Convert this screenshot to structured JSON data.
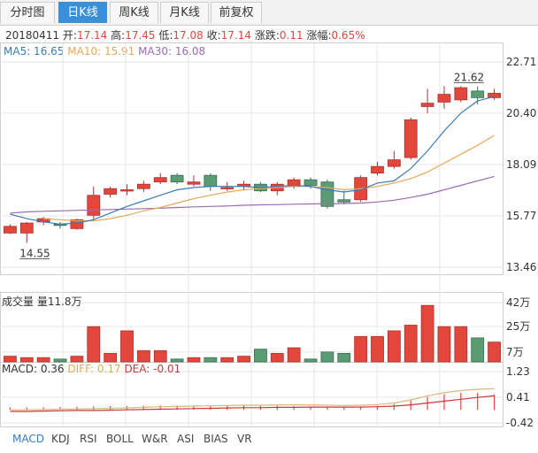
{
  "tabs": [
    {
      "label": "分时图",
      "active": false
    },
    {
      "label": "日K线",
      "active": true
    },
    {
      "label": "周K线",
      "active": false
    },
    {
      "label": "月K线",
      "active": false
    },
    {
      "label": "前复权",
      "active": false
    }
  ],
  "info": {
    "date": "20180411",
    "open_label": "开:",
    "open": "17.14",
    "high_label": "高:",
    "high": "17.45",
    "low_label": "低:",
    "low": "17.08",
    "close_label": "收:",
    "close": "17.14",
    "change_label": "涨跌:",
    "change": "0.11",
    "pct_label": "涨幅:",
    "pct": "0.65%"
  },
  "ma_legend": {
    "ma5": "MA5: 16.65",
    "ma10": "MA10: 15.91",
    "ma30": "MA30: 16.08"
  },
  "volume_title": "成交量 量11.8万",
  "macd_legend": {
    "macd": "MACD: 0.36",
    "diff": "DIFF: 0.17",
    "dea": "DEA: -0.01"
  },
  "indicator_tabs": [
    {
      "label": "MACD",
      "active": true
    },
    {
      "label": "KDJ",
      "active": false
    },
    {
      "label": "RSI",
      "active": false
    },
    {
      "label": "BOLL",
      "active": false
    },
    {
      "label": "W&R",
      "active": false
    },
    {
      "label": "ASI",
      "active": false
    },
    {
      "label": "BIAS",
      "active": false
    },
    {
      "label": "VR",
      "active": false
    }
  ],
  "colors": {
    "up": "#e3463b",
    "down": "#5a9c74",
    "ma5": "#3a7bb5",
    "ma10": "#e8a85a",
    "ma30": "#9b6bb5",
    "grid": "#e6e6e6",
    "dea": "#c9383c",
    "diff": "#d8b878"
  },
  "chart_data": {
    "type": "candlestick",
    "price_axis": {
      "ticks": [
        "22.71",
        "20.40",
        "18.09",
        "15.77",
        "13.46"
      ],
      "ylim": [
        13.46,
        22.71
      ]
    },
    "volume_axis": {
      "ticks": [
        "42万",
        "25万",
        "7万"
      ],
      "ylim": [
        0,
        42
      ]
    },
    "macd_axis": {
      "ticks": [
        "1.23",
        "0.41",
        "-0.42"
      ],
      "ylim": [
        -0.42,
        1.23
      ]
    },
    "annotations": [
      {
        "text": "14.55",
        "index": 1,
        "value": 14.55
      },
      {
        "text": "21.62",
        "index": 27,
        "value": 21.62
      }
    ],
    "candles": [
      {
        "open": 15.0,
        "close": 15.3,
        "high": 15.4,
        "low": 14.95,
        "volume": 4
      },
      {
        "open": 15.0,
        "close": 15.45,
        "high": 15.5,
        "low": 14.55,
        "volume": 3
      },
      {
        "open": 15.5,
        "close": 15.65,
        "high": 15.72,
        "low": 15.35,
        "volume": 3
      },
      {
        "open": 15.4,
        "close": 15.38,
        "high": 15.5,
        "low": 15.2,
        "volume": 2
      },
      {
        "open": 15.2,
        "close": 15.6,
        "high": 15.65,
        "low": 15.15,
        "volume": 4
      },
      {
        "open": 15.8,
        "close": 16.7,
        "high": 17.1,
        "low": 15.6,
        "volume": 25
      },
      {
        "open": 16.75,
        "close": 17.0,
        "high": 17.1,
        "low": 16.6,
        "volume": 6
      },
      {
        "open": 16.95,
        "close": 16.95,
        "high": 17.2,
        "low": 16.7,
        "volume": 22
      },
      {
        "open": 17.0,
        "close": 17.2,
        "high": 17.35,
        "low": 16.85,
        "volume": 8
      },
      {
        "open": 17.3,
        "close": 17.5,
        "high": 17.7,
        "low": 17.2,
        "volume": 8
      },
      {
        "open": 17.6,
        "close": 17.3,
        "high": 17.7,
        "low": 17.2,
        "volume": 2
      },
      {
        "open": 17.2,
        "close": 17.3,
        "high": 17.6,
        "low": 17.1,
        "volume": 3
      },
      {
        "open": 17.6,
        "close": 17.1,
        "high": 17.7,
        "low": 16.9,
        "volume": 3
      },
      {
        "open": 17.0,
        "close": 17.05,
        "high": 17.3,
        "low": 16.9,
        "volume": 3
      },
      {
        "open": 17.1,
        "close": 17.2,
        "high": 17.35,
        "low": 16.95,
        "volume": 4
      },
      {
        "open": 17.2,
        "close": 16.9,
        "high": 17.3,
        "low": 16.85,
        "volume": 9
      },
      {
        "open": 16.9,
        "close": 17.2,
        "high": 17.3,
        "low": 16.7,
        "volume": 6
      },
      {
        "open": 17.1,
        "close": 17.4,
        "high": 17.5,
        "low": 17.0,
        "volume": 10
      },
      {
        "open": 17.4,
        "close": 17.15,
        "high": 17.5,
        "low": 17.0,
        "volume": 2
      },
      {
        "open": 17.3,
        "close": 16.2,
        "high": 17.4,
        "low": 16.1,
        "volume": 7
      },
      {
        "open": 16.5,
        "close": 16.4,
        "high": 16.9,
        "low": 16.3,
        "volume": 6
      },
      {
        "open": 16.5,
        "close": 17.5,
        "high": 17.6,
        "low": 16.4,
        "volume": 18
      },
      {
        "open": 17.7,
        "close": 18.0,
        "high": 18.2,
        "low": 17.6,
        "volume": 18
      },
      {
        "open": 18.0,
        "close": 18.3,
        "high": 18.7,
        "low": 17.9,
        "volume": 22
      },
      {
        "open": 18.4,
        "close": 20.1,
        "high": 20.2,
        "low": 18.3,
        "volume": 26
      },
      {
        "open": 20.7,
        "close": 20.85,
        "high": 21.5,
        "low": 20.4,
        "volume": 40
      },
      {
        "open": 20.9,
        "close": 21.25,
        "high": 21.62,
        "low": 20.6,
        "volume": 25
      },
      {
        "open": 21.0,
        "close": 21.55,
        "high": 21.62,
        "low": 20.9,
        "volume": 25
      },
      {
        "open": 21.4,
        "close": 21.1,
        "high": 21.6,
        "low": 20.8,
        "volume": 17
      },
      {
        "open": 21.1,
        "close": 21.3,
        "high": 21.5,
        "low": 21.0,
        "volume": 14
      }
    ],
    "ma5": [
      15.85,
      15.65,
      15.5,
      15.4,
      15.45,
      15.6,
      15.9,
      16.2,
      16.45,
      16.7,
      16.95,
      17.05,
      17.1,
      17.1,
      17.1,
      17.05,
      17.1,
      17.15,
      17.1,
      16.95,
      16.85,
      16.95,
      17.25,
      17.35,
      17.9,
      18.7,
      19.6,
      20.4,
      20.95,
      21.15
    ],
    "ma10": [
      null,
      null,
      15.65,
      15.6,
      15.55,
      15.55,
      15.65,
      15.8,
      16.0,
      16.15,
      16.35,
      16.55,
      16.7,
      16.85,
      16.95,
      17.0,
      17.05,
      17.1,
      17.1,
      17.05,
      16.95,
      17.0,
      17.1,
      17.25,
      17.45,
      17.75,
      18.15,
      18.55,
      18.95,
      19.4
    ],
    "ma30": [
      15.9,
      15.95,
      15.98,
      16.0,
      16.02,
      16.04,
      16.06,
      16.08,
      16.1,
      16.12,
      16.15,
      16.18,
      16.2,
      16.22,
      16.25,
      16.27,
      16.28,
      16.3,
      16.31,
      16.32,
      16.33,
      16.35,
      16.4,
      16.48,
      16.6,
      16.75,
      16.95,
      17.15,
      17.35,
      17.55
    ],
    "macd_diff": [
      0.0,
      0.0,
      0.01,
      0.02,
      0.03,
      0.04,
      0.05,
      0.06,
      0.08,
      0.1,
      0.11,
      0.12,
      0.13,
      0.14,
      0.15,
      0.15,
      0.16,
      0.16,
      0.16,
      0.15,
      0.14,
      0.15,
      0.17,
      0.22,
      0.32,
      0.45,
      0.55,
      0.62,
      0.66,
      0.68
    ],
    "macd_dea": [
      -0.05,
      -0.05,
      -0.04,
      -0.03,
      -0.02,
      -0.02,
      -0.01,
      0.0,
      0.01,
      0.02,
      0.03,
      0.04,
      0.05,
      0.06,
      0.07,
      0.07,
      0.08,
      0.08,
      0.09,
      0.09,
      0.09,
      0.09,
      0.1,
      0.12,
      0.16,
      0.22,
      0.28,
      0.34,
      0.4,
      0.45
    ],
    "macd_hist": [
      0.08,
      0.08,
      0.08,
      0.09,
      0.1,
      0.11,
      0.12,
      0.12,
      0.13,
      0.14,
      0.14,
      0.14,
      0.14,
      0.14,
      0.14,
      0.13,
      0.13,
      0.12,
      0.11,
      0.1,
      0.08,
      0.09,
      0.12,
      0.18,
      0.3,
      0.42,
      0.5,
      0.55,
      0.55,
      0.5
    ]
  }
}
